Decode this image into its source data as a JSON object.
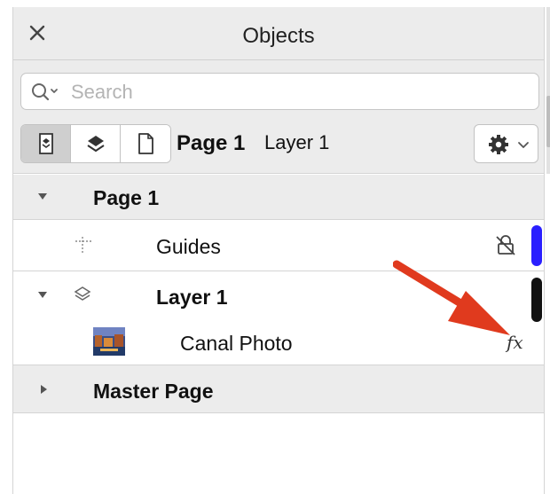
{
  "panel": {
    "title": "Objects",
    "close_icon": "close-icon"
  },
  "search": {
    "placeholder": "Search",
    "value": ""
  },
  "toolbar": {
    "view_buttons": [
      "layer-view-icon",
      "layers-stack-icon",
      "page-icon"
    ],
    "active_view": 0,
    "current_page": "Page 1",
    "current_layer": "Layer 1",
    "settings_icon": "gear-icon"
  },
  "tree": {
    "page": {
      "label": "Page 1",
      "expanded": true
    },
    "guides": {
      "label": "Guides",
      "icon": "guides-icon",
      "lock_icon": "lock-disabled-icon",
      "color": "#2a1fff"
    },
    "layer": {
      "label": "Layer 1",
      "expanded": true,
      "color": "#111111"
    },
    "canal_photo": {
      "label": "Canal Photo",
      "effect_label": "fx"
    },
    "master_page": {
      "label": "Master Page",
      "expanded": false
    }
  },
  "annotation": {
    "arrow_color": "#e03a1e"
  }
}
